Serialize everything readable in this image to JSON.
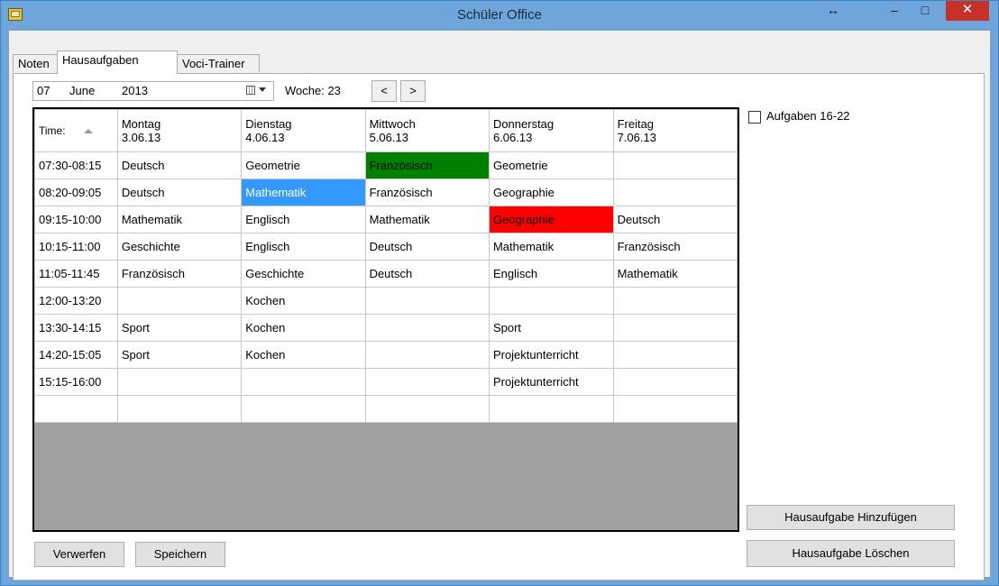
{
  "window": {
    "title": "Schüler Office",
    "resize_glyph": "↔",
    "minimize_glyph": "–",
    "maximize_glyph": "□",
    "close_glyph": "✕"
  },
  "tabs": [
    {
      "label": "Noten"
    },
    {
      "label": "Hausaufgaben"
    },
    {
      "label": "Voci-Trainer"
    }
  ],
  "date": {
    "day": "07",
    "month": "June",
    "year": "2013"
  },
  "woche": "Woche: 23",
  "nav": {
    "prev": "<",
    "next": ">"
  },
  "table": {
    "headers": [
      {
        "day": "Time:",
        "date": ""
      },
      {
        "day": "Montag",
        "date": "3.06.13"
      },
      {
        "day": "Dienstag",
        "date": "4.06.13"
      },
      {
        "day": "Mittwoch",
        "date": "5.06.13"
      },
      {
        "day": "Donnerstag",
        "date": "6.06.13"
      },
      {
        "day": "Freitag",
        "date": "7.06.13"
      }
    ],
    "rows": [
      [
        "07:30-08:15",
        "Deutsch",
        "Geometrie",
        "Französisch",
        "Geometrie",
        ""
      ],
      [
        "08:20-09:05",
        "Deutsch",
        "Mathematik",
        "Französisch",
        "Geographie",
        ""
      ],
      [
        "09:15-10:00",
        "Mathematik",
        "Englisch",
        "Mathematik",
        "Geographie",
        "Deutsch"
      ],
      [
        "10:15-11:00",
        "Geschichte",
        "Englisch",
        "Deutsch",
        "Mathematik",
        "Französisch"
      ],
      [
        "11:05-11:45",
        "Französisch",
        "Geschichte",
        "Deutsch",
        "Englisch",
        "Mathematik"
      ],
      [
        "12:00-13:20",
        "",
        "Kochen",
        "",
        "",
        ""
      ],
      [
        "13:30-14:15",
        "Sport",
        "Kochen",
        "",
        "Sport",
        ""
      ],
      [
        "14:20-15:05",
        "Sport",
        "Kochen",
        "",
        "Projektunterricht",
        ""
      ],
      [
        "15:15-16:00",
        "",
        "",
        "",
        "Projektunterricht",
        ""
      ],
      [
        "",
        "",
        "",
        "",
        "",
        ""
      ]
    ],
    "highlights": [
      {
        "row": 0,
        "col": 3,
        "color": "#008000"
      },
      {
        "row": 1,
        "col": 2,
        "color": "#3399ff",
        "text_color": "#ffffff"
      },
      {
        "row": 2,
        "col": 4,
        "color": "#ff0000"
      }
    ]
  },
  "checkbox": {
    "label": "Aufgaben 16-22",
    "checked": false
  },
  "buttons": {
    "add": "Hausaufgabe Hinzufügen",
    "delete": "Hausaufgabe Löschen",
    "discard": "Verwerfen",
    "save": "Speichern"
  }
}
